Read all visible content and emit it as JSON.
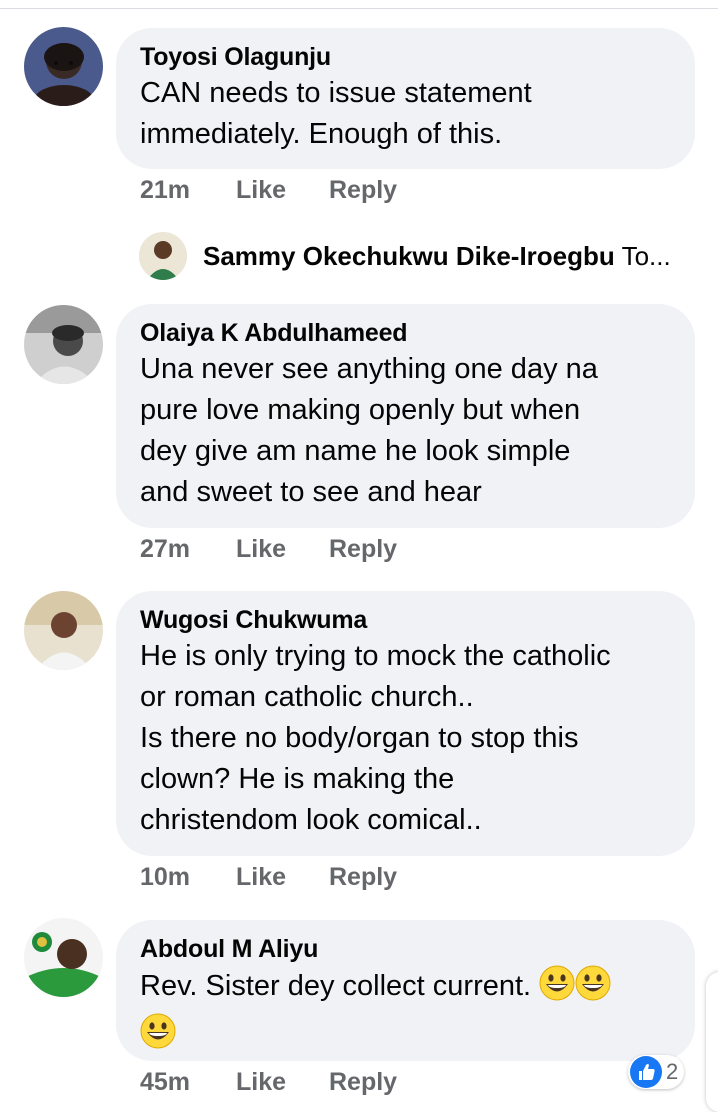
{
  "comments": [
    {
      "author": "Toyosi Olagunju",
      "text": "CAN needs to issue statement\nimmediately. Enough of this.",
      "time": "21m",
      "like_label": "Like",
      "reply_label": "Reply"
    },
    {
      "author": "Olaiya K Abdulhameed",
      "text": "Una never see anything one day na\npure love making openly but when\ndey give am name he look simple\nand sweet to see and hear",
      "time": "27m",
      "like_label": "Like",
      "reply_label": "Reply"
    },
    {
      "author": "Wugosi Chukwuma",
      "text": "He is only trying to mock the catholic\nor roman catholic church..\nIs there no body/organ to stop this\nclown? He is making the\nchristendom look comical..",
      "time": "10m",
      "like_label": "Like",
      "reply_label": "Reply"
    },
    {
      "author": "Abdoul M Aliyu",
      "text": "Rev. Sister dey collect current.",
      "time": "45m",
      "like_label": "Like",
      "reply_label": "Reply"
    }
  ],
  "reply_preview": {
    "author": "Sammy Okechukwu Dike-Iroegbu",
    "snippet": "To..."
  },
  "reactions": {
    "icon": "like-icon",
    "count": "2"
  },
  "colors": {
    "bubble": "#f0f2f5",
    "meta": "#65676b",
    "like_blue": "#1877f2",
    "emoji_yellow": "#ffd93b"
  },
  "icons": {
    "emoji": "grinning-face-icon"
  }
}
